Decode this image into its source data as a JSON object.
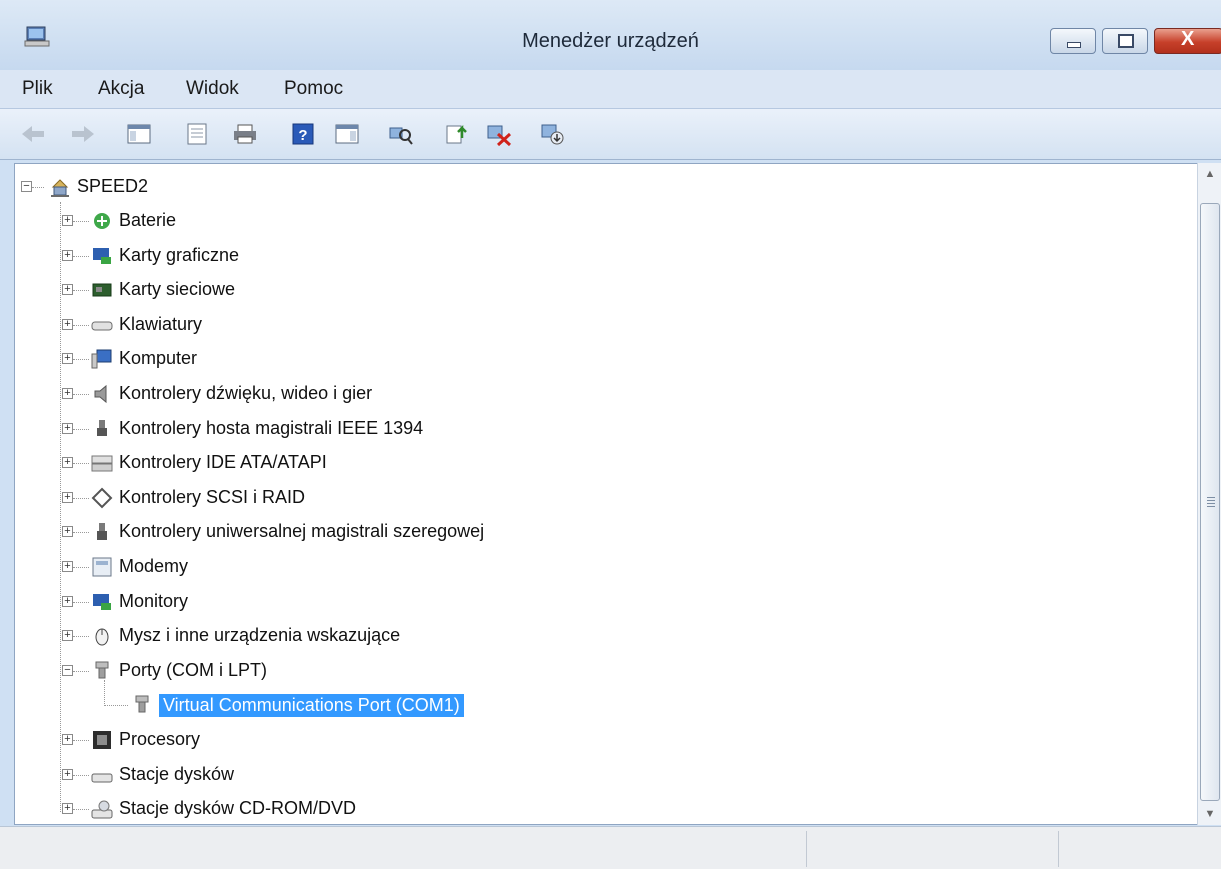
{
  "window": {
    "title": "Menedżer urządzeń",
    "close_label": "X"
  },
  "menu": [
    "Plik",
    "Akcja",
    "Widok",
    "Pomoc"
  ],
  "toolbar": {
    "icons": [
      "back-arrow-icon",
      "forward-arrow-icon",
      "show-hide-console-tree-icon",
      "properties-icon",
      "print-icon",
      "help-icon",
      "show-action-pane-icon",
      "scan-hardware-icon",
      "update-driver-icon",
      "uninstall-device-icon",
      "disable-device-icon"
    ]
  },
  "tree": {
    "root": {
      "label": "SPEED2",
      "icon": "computer-network-icon",
      "expanded": true
    },
    "categories": [
      {
        "label": "Baterie",
        "icon": "battery-icon",
        "expander": "+"
      },
      {
        "label": "Karty graficzne",
        "icon": "display-adapter-icon",
        "expander": "+"
      },
      {
        "label": "Karty sieciowe",
        "icon": "network-card-icon",
        "expander": "+"
      },
      {
        "label": "Klawiatury",
        "icon": "keyboard-icon",
        "expander": "+"
      },
      {
        "label": "Komputer",
        "icon": "computer-icon",
        "expander": "+"
      },
      {
        "label": "Kontrolery dźwięku, wideo i gier",
        "icon": "speaker-icon",
        "expander": "+"
      },
      {
        "label": "Kontrolery hosta magistrali IEEE 1394",
        "icon": "firewire-icon",
        "expander": "+"
      },
      {
        "label": "Kontrolery IDE ATA/ATAPI",
        "icon": "ide-controller-icon",
        "expander": "+"
      },
      {
        "label": "Kontrolery SCSI i RAID",
        "icon": "scsi-icon",
        "expander": "+"
      },
      {
        "label": "Kontrolery uniwersalnej magistrali szeregowej",
        "icon": "usb-icon",
        "expander": "+"
      },
      {
        "label": "Modemy",
        "icon": "modem-icon",
        "expander": "+"
      },
      {
        "label": "Monitory",
        "icon": "monitor-icon",
        "expander": "+"
      },
      {
        "label": "Mysz i inne urządzenia wskazujące",
        "icon": "mouse-icon",
        "expander": "+"
      },
      {
        "label": "Porty (COM i LPT)",
        "icon": "port-icon",
        "expander": "−",
        "expanded": true,
        "children": [
          {
            "label": "Virtual Communications Port (COM1)",
            "icon": "port-icon",
            "selected": true
          }
        ]
      },
      {
        "label": "Procesory",
        "icon": "processor-icon",
        "expander": "+"
      },
      {
        "label": "Stacje dysków",
        "icon": "disk-drive-icon",
        "expander": "+"
      },
      {
        "label": "Stacje dysków CD-ROM/DVD",
        "icon": "cdrom-icon",
        "expander": "+"
      }
    ]
  },
  "colors": {
    "selection": "#3399ff",
    "titlebar": "#c6d9ef"
  }
}
